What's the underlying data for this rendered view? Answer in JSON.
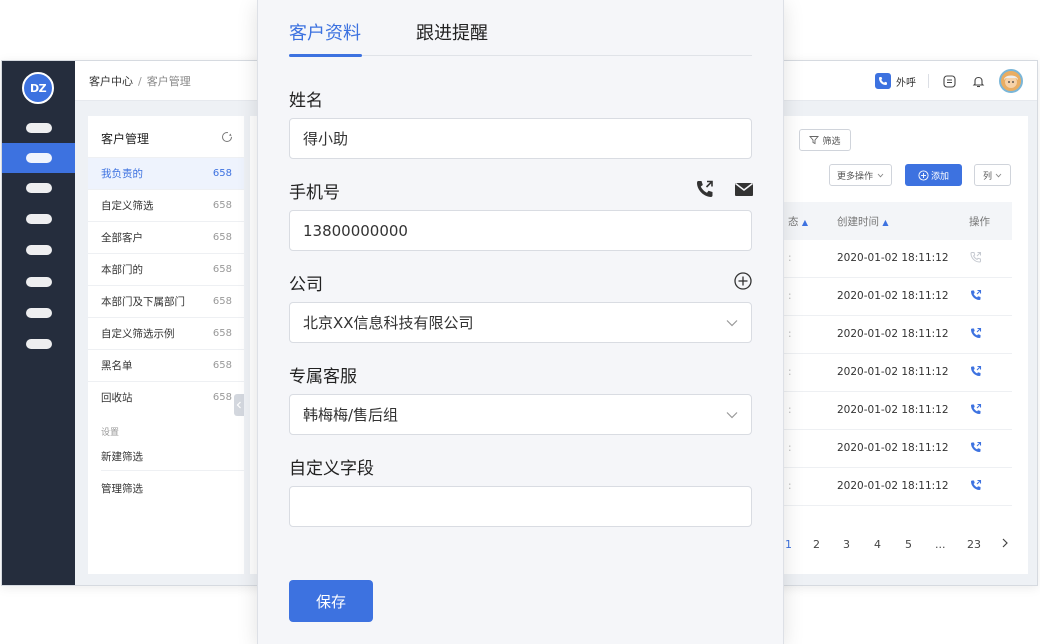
{
  "app": {
    "logo_text": "DZ",
    "breadcrumb": {
      "root": "客户中心",
      "separator": "/",
      "current": "客户管理"
    },
    "topbar": {
      "call_label": "外呼"
    },
    "rail": {
      "item_count": 8,
      "active_index": 1
    }
  },
  "left_panel": {
    "title": "客户管理",
    "items": [
      {
        "label": "我负责的",
        "count": "658",
        "active": true
      },
      {
        "label": "自定义筛选",
        "count": "658"
      },
      {
        "label": "全部客户",
        "count": "658"
      },
      {
        "label": "本部门的",
        "count": "658"
      },
      {
        "label": "本部门及下属部门",
        "count": "658"
      },
      {
        "label": "自定义筛选示例",
        "count": "658"
      },
      {
        "label": "黑名单",
        "count": "658"
      },
      {
        "label": "回收站",
        "count": "658"
      }
    ],
    "settings_label": "设置",
    "new_filter": "新建筛选",
    "manage_filter": "管理筛选"
  },
  "table": {
    "filter_label": "筛选",
    "more_actions": "更多操作",
    "add_label": "添加",
    "columns_label": "列",
    "headers": {
      "status_partial": "态",
      "created": "创建时间",
      "op": "操作"
    },
    "rows": [
      {
        "created": "2020-01-02 18:11:12"
      },
      {
        "created": "2020-01-02 18:11:12"
      },
      {
        "created": "2020-01-02 18:11:12"
      },
      {
        "created": "2020-01-02 18:11:12"
      },
      {
        "created": "2020-01-02 18:11:12"
      },
      {
        "created": "2020-01-02 18:11:12"
      },
      {
        "created": "2020-01-02 18:11:12"
      }
    ],
    "pagination": [
      "1",
      "2",
      "3",
      "4",
      "5",
      "...",
      "23"
    ],
    "current_page": "1"
  },
  "modal": {
    "tabs": [
      "客户资料",
      "跟进提醒"
    ],
    "active_tab": 0,
    "fields": {
      "name": {
        "label": "姓名",
        "value": "得小助"
      },
      "phone": {
        "label": "手机号",
        "value": "13800000000"
      },
      "company": {
        "label": "公司",
        "value": "北京XX信息科技有限公司"
      },
      "service": {
        "label": "专属客服",
        "value": "韩梅梅/售后组"
      },
      "custom": {
        "label": "自定义字段",
        "value": ""
      }
    },
    "save_label": "保存"
  },
  "colors": {
    "accent": "#3d72e0",
    "rail": "#252d3d",
    "panel_bg": "#f5f6f9"
  }
}
